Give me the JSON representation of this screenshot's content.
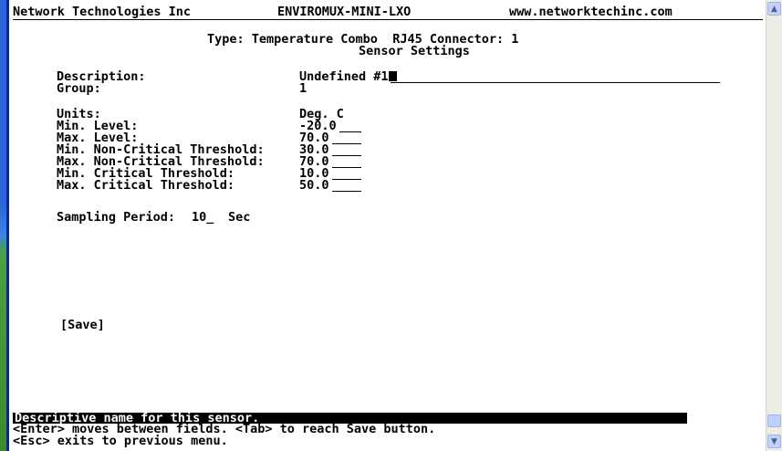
{
  "header": {
    "company": "Network Technologies Inc",
    "product": "ENVIROMUX-MINI-LXO",
    "website": "www.networktechinc.com"
  },
  "title": {
    "line1": "Type: Temperature Combo  RJ45 Connector: 1",
    "line2": "Sensor Settings"
  },
  "fields": {
    "description_label": "Description:",
    "description_value": "Undefined #1",
    "group_label": "Group:",
    "group_value": "1",
    "units_label": "Units:",
    "units_value": "Deg. C",
    "min_level_label": "Min. Level:",
    "min_level_value": "-20.0",
    "max_level_label": "Max. Level:",
    "max_level_value": "70.0",
    "min_noncrit_label": "Min. Non-Critical Threshold:",
    "min_noncrit_value": "30.0",
    "max_noncrit_label": "Max. Non-Critical Threshold:",
    "max_noncrit_value": "70.0",
    "min_crit_label": "Min. Critical Threshold:",
    "min_crit_value": "10.0",
    "max_crit_label": "Max. Critical Threshold:",
    "max_crit_value": "50.0",
    "sampling_label": "Sampling Period:",
    "sampling_value": "10_",
    "sampling_unit": "Sec"
  },
  "save_button": "[Save]",
  "status_bar": "Descriptive name for this sensor.",
  "help": {
    "line1": "<Enter> moves between fields. <Tab> to reach Save button.",
    "line2": "<Esc> exits to previous menu."
  },
  "scrollbar": {
    "up_icon": "scroll-up-arrow",
    "down_icon": "scroll-down-arrow"
  }
}
